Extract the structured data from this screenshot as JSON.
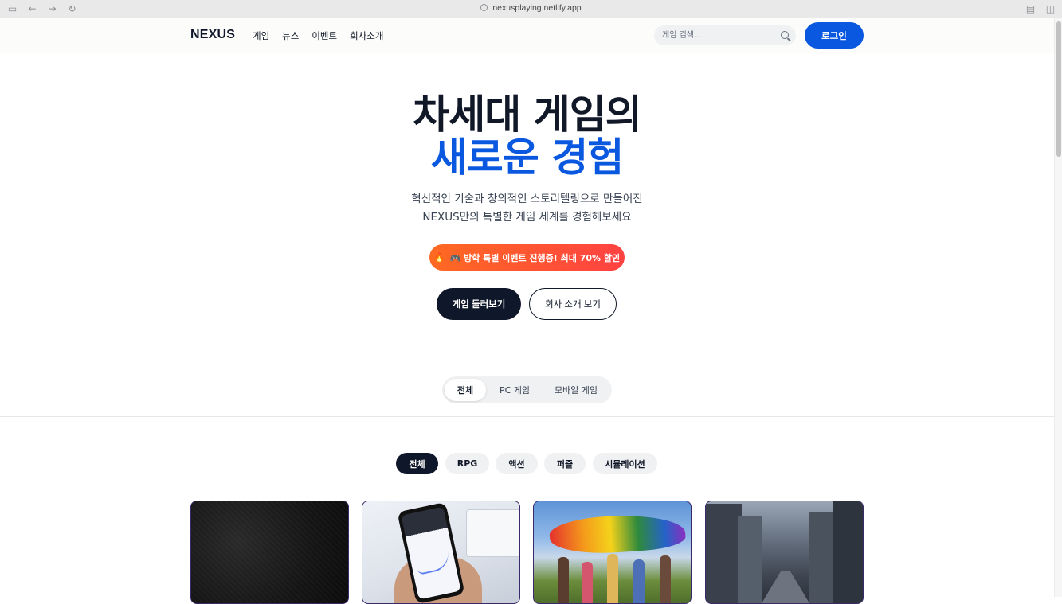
{
  "browser": {
    "url": "nexusplaying.netlify.app"
  },
  "header": {
    "logo": "NEXUS",
    "nav": [
      "게임",
      "뉴스",
      "이벤트",
      "회사소개"
    ],
    "search_placeholder": "게임 검색...",
    "login_label": "로그인"
  },
  "hero": {
    "title_line1": "차세대 게임의",
    "title_line2": "새로운 경험",
    "subtitle_line1": "혁신적인 기술과 창의적인 스토리텔링으로 만들어진",
    "subtitle_line2": "NEXUS만의 특별한 게임 세계를 경험해보세요",
    "event_text": "🎮 방학 특별 이벤트 진행중! 최대 70% 할인",
    "primary_button": "게임 둘러보기",
    "secondary_button": "회사 소개 보기"
  },
  "platform_tabs": [
    {
      "label": "전체",
      "active": true
    },
    {
      "label": "PC 게임",
      "active": false
    },
    {
      "label": "모바일 게임",
      "active": false
    }
  ],
  "genre_chips": [
    {
      "label": "전체",
      "active": true
    },
    {
      "label": "RPG",
      "active": false
    },
    {
      "label": "액션",
      "active": false
    },
    {
      "label": "퍼즐",
      "active": false
    },
    {
      "label": "시뮬레이션",
      "active": false
    }
  ],
  "colors": {
    "accent": "#0a58e0",
    "dark": "#0f172a",
    "event_gradient_start": "#ff6a22",
    "event_gradient_end": "#ff4242",
    "card_border": "#3b2a6b"
  },
  "icons": {
    "search": "search-icon",
    "event": "fire-icon"
  }
}
